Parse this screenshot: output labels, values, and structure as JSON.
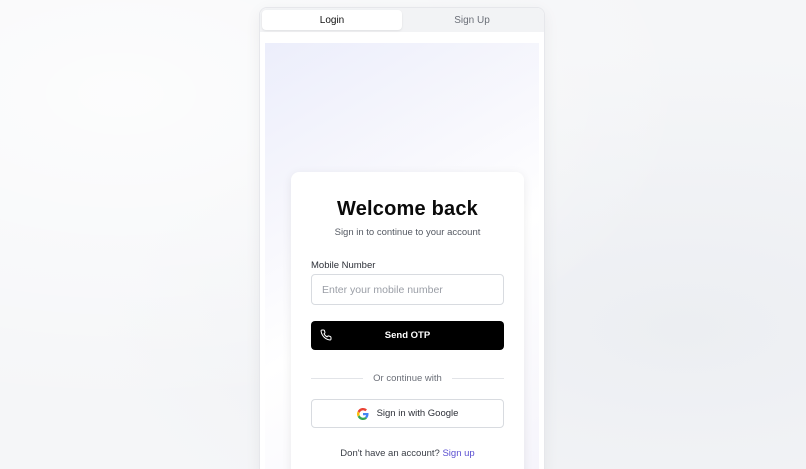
{
  "tabs": [
    {
      "label": "Login",
      "active": true
    },
    {
      "label": "Sign Up",
      "active": false
    }
  ],
  "card": {
    "title": "Welcome back",
    "subtitle": "Sign in to continue to your account",
    "mobile_label": "Mobile Number",
    "mobile_placeholder": "Enter your mobile number",
    "mobile_value": "",
    "send_otp_label": "Send OTP",
    "send_otp_icon": "phone-icon",
    "divider_text": "Or continue with",
    "google_label": "Sign in with Google",
    "google_icon": "google-icon",
    "footer_prompt": "Don't have an account?",
    "footer_link": "Sign up"
  },
  "colors": {
    "primary_button": "#000000",
    "link": "#5b4fd1",
    "page_background": "#f5f6f8"
  }
}
